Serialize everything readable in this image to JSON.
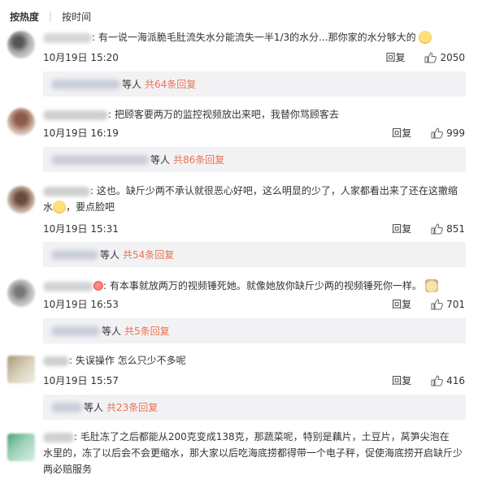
{
  "tabs": [
    {
      "label": "按热度",
      "active": true
    },
    {
      "label": "按时间",
      "active": false
    }
  ],
  "reply_label": "回复",
  "comments": [
    {
      "text": ": 有一说一海派脆毛肚流失水分能流失一半1/3的水分...那你家的水分够大的",
      "time": "10月19日 15:20",
      "likes": "2050",
      "replies_etc": "等人",
      "replies_count": "共64条回复"
    },
    {
      "text": ": 把顾客要两万的监控视频放出来吧，我替你骂顾客去",
      "time": "10月19日 16:19",
      "likes": "999",
      "replies_etc": "等人",
      "replies_count": "共86条回复"
    },
    {
      "text_line1": ": 这也。缺斤少两不承认就很恶心好吧，这么明显的少了，人家都看出来了还在这撤缩",
      "text_line2a": "水",
      "text_line2b": "，要点脸吧",
      "time": "10月19日 15:31",
      "likes": "851",
      "replies_etc": "等人",
      "replies_count": "共54条回复"
    },
    {
      "text": ": 有本事就放两万的视频锤死她。就像她放你缺斤少两的视频锤死你一样。",
      "time": "10月19日 16:53",
      "likes": "701",
      "replies_etc": "等人",
      "replies_count": "共5条回复"
    },
    {
      "text": ": 失误操作  怎么只少不多呢",
      "time": "10月19日 15:57",
      "likes": "416",
      "replies_etc": "等人",
      "replies_count": "共23条回复"
    },
    {
      "text_line1": ": 毛肚冻了之后都能从200克变成138克，那蔬菜呢，特别是藕片，土豆片，莴笋尖泡在",
      "text_line2": "水里的，冻了以后会不会更缩水，那大家以后吃海底捞都得带一个电子秤，促使海底捞开启缺斤少",
      "text_line3": "两必赔服务"
    }
  ]
}
